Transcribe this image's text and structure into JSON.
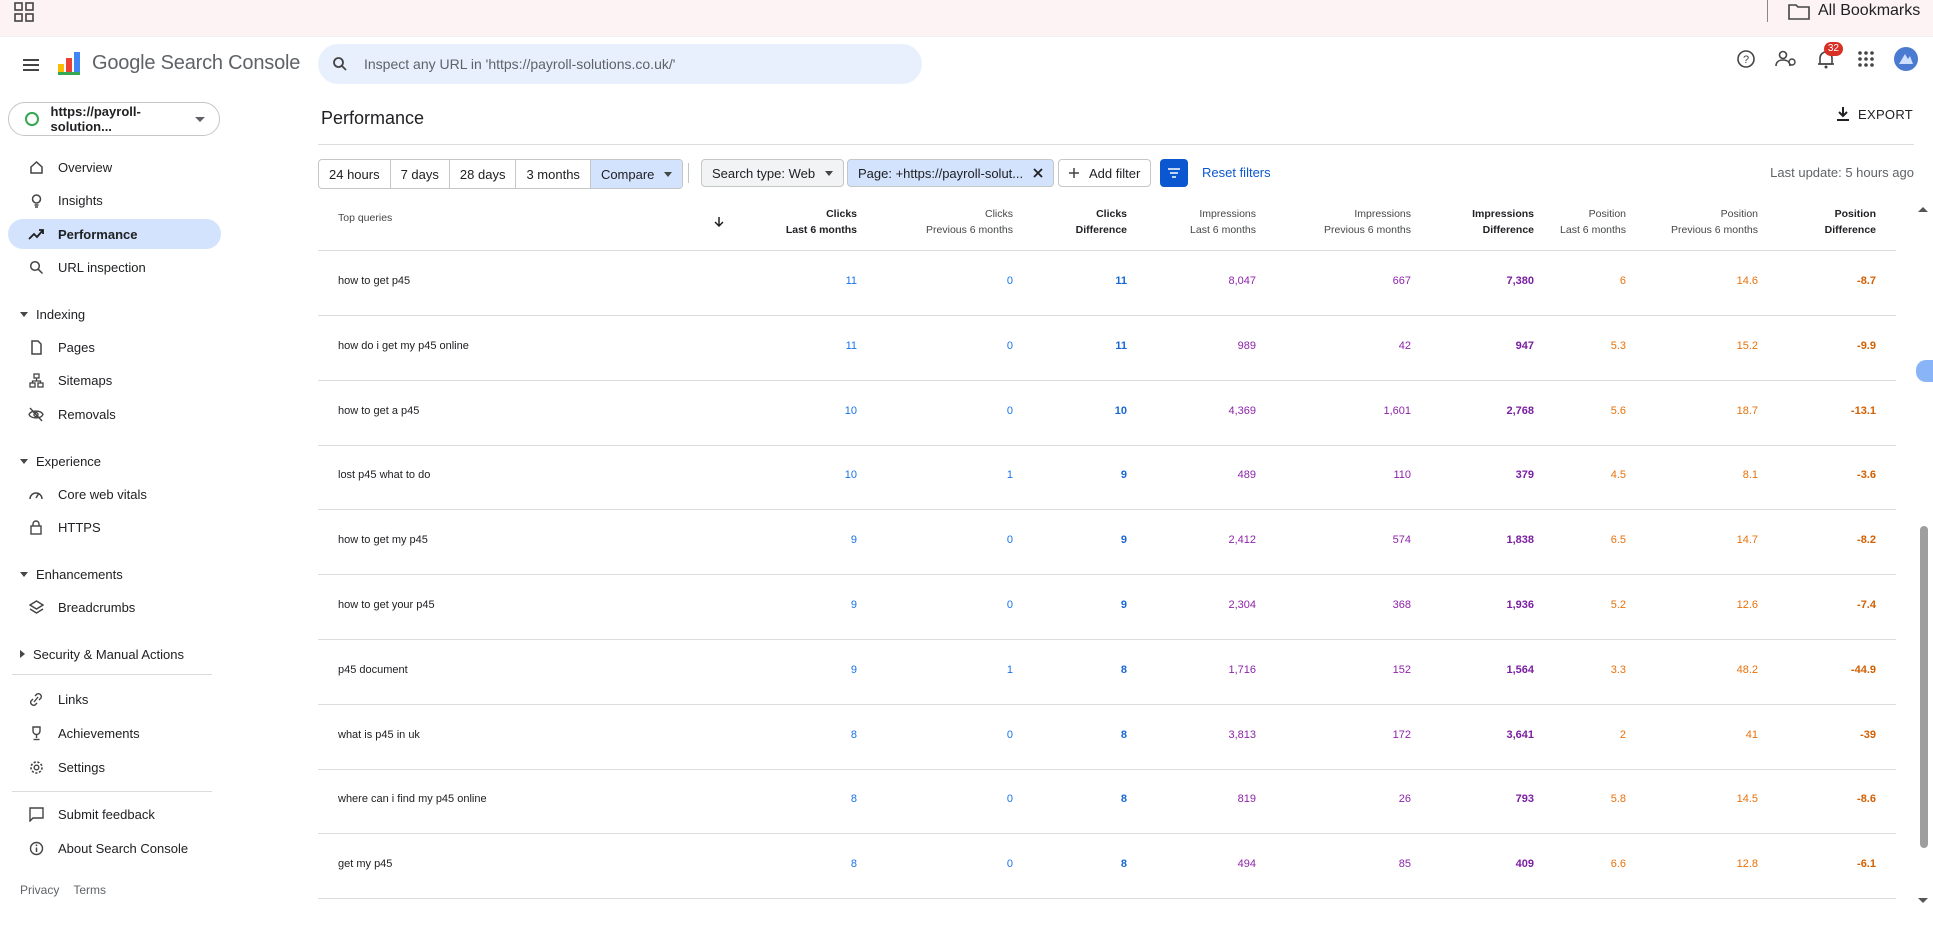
{
  "bookmarks": {
    "all_label": "All Bookmarks"
  },
  "header": {
    "app_name": "Google Search Console",
    "search_placeholder": "Inspect any URL in 'https://payroll-solutions.co.uk/'",
    "notification_count": "32"
  },
  "sidebar": {
    "property": "https://payroll-solution...",
    "items": {
      "overview": "Overview",
      "insights": "Insights",
      "performance": "Performance",
      "url_inspection": "URL inspection",
      "indexing": "Indexing",
      "pages": "Pages",
      "sitemaps": "Sitemaps",
      "removals": "Removals",
      "experience": "Experience",
      "core_web_vitals": "Core web vitals",
      "https": "HTTPS",
      "enhancements": "Enhancements",
      "breadcrumbs": "Breadcrumbs",
      "security": "Security & Manual Actions",
      "links": "Links",
      "achievements": "Achievements",
      "settings": "Settings",
      "submit_feedback": "Submit feedback",
      "about": "About Search Console"
    },
    "footer": {
      "privacy": "Privacy",
      "terms": "Terms"
    }
  },
  "main": {
    "title": "Performance",
    "export_label": "EXPORT",
    "date_ranges": [
      "24 hours",
      "7 days",
      "28 days",
      "3 months"
    ],
    "compare_label": "Compare",
    "search_type": "Search type: Web",
    "page_filter": "Page: +https://payroll-solut...",
    "add_filter": "Add filter",
    "reset_filters": "Reset filters",
    "last_update": "Last update: 5 hours ago"
  },
  "table": {
    "query_header": "Top queries",
    "columns": [
      {
        "l1": "Clicks",
        "l2": "Last 6 months"
      },
      {
        "l1": "Clicks",
        "l2": "Previous 6 months"
      },
      {
        "l1": "Clicks",
        "l2": "Difference"
      },
      {
        "l1": "Impressions",
        "l2": "Last 6 months"
      },
      {
        "l1": "Impressions",
        "l2": "Previous 6 months"
      },
      {
        "l1": "Impressions",
        "l2": "Difference"
      },
      {
        "l1": "Position",
        "l2": "Last 6 months"
      },
      {
        "l1": "Position",
        "l2": "Previous 6 months"
      },
      {
        "l1": "Position",
        "l2": "Difference"
      }
    ],
    "rows": [
      {
        "query": "how to get p45",
        "v": [
          "11",
          "0",
          "11",
          "8,047",
          "667",
          "7,380",
          "6",
          "14.6",
          "-8.7"
        ]
      },
      {
        "query": "how do i get my p45 online",
        "v": [
          "11",
          "0",
          "11",
          "989",
          "42",
          "947",
          "5.3",
          "15.2",
          "-9.9"
        ]
      },
      {
        "query": "how to get a p45",
        "v": [
          "10",
          "0",
          "10",
          "4,369",
          "1,601",
          "2,768",
          "5.6",
          "18.7",
          "-13.1"
        ]
      },
      {
        "query": "lost p45 what to do",
        "v": [
          "10",
          "1",
          "9",
          "489",
          "110",
          "379",
          "4.5",
          "8.1",
          "-3.6"
        ]
      },
      {
        "query": "how to get my p45",
        "v": [
          "9",
          "0",
          "9",
          "2,412",
          "574",
          "1,838",
          "6.5",
          "14.7",
          "-8.2"
        ]
      },
      {
        "query": "how to get your p45",
        "v": [
          "9",
          "0",
          "9",
          "2,304",
          "368",
          "1,936",
          "5.2",
          "12.6",
          "-7.4"
        ]
      },
      {
        "query": "p45 document",
        "v": [
          "9",
          "1",
          "8",
          "1,716",
          "152",
          "1,564",
          "3.3",
          "48.2",
          "-44.9"
        ]
      },
      {
        "query": "what is p45 in uk",
        "v": [
          "8",
          "0",
          "8",
          "3,813",
          "172",
          "3,641",
          "2",
          "41",
          "-39"
        ]
      },
      {
        "query": "where can i find my p45 online",
        "v": [
          "8",
          "0",
          "8",
          "819",
          "26",
          "793",
          "5.8",
          "14.5",
          "-8.6"
        ]
      },
      {
        "query": "get my p45",
        "v": [
          "8",
          "0",
          "8",
          "494",
          "85",
          "409",
          "6.6",
          "12.8",
          "-6.1"
        ]
      }
    ]
  }
}
